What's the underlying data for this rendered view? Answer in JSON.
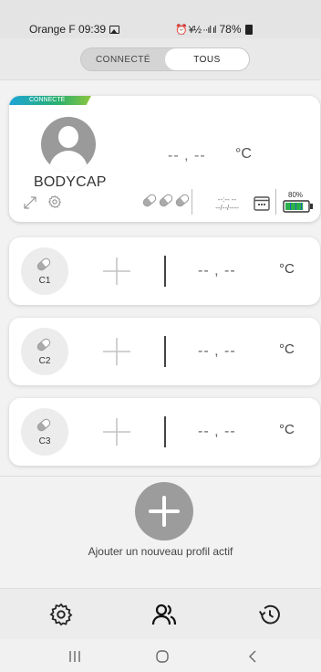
{
  "status_bar": {
    "carrier_time": "Orange F 09:39",
    "signal_glyphs": "⏰ ¥½ ··ıl ıl",
    "battery": "78%"
  },
  "filter": {
    "connected_label": "CONNECTÉ",
    "all_label": "TOUS",
    "active": "all"
  },
  "main_profile": {
    "badge": "CONNECTÉ",
    "name": "BODYCAP",
    "temperature": "-- , --",
    "unit": "°C",
    "time": "--:-- --",
    "date": "--/--/----",
    "battery_label": "80%",
    "battery_level": 0.8,
    "battery_color": "#2bb14a"
  },
  "capsules": [
    {
      "label": "C1",
      "temperature": "-- , --",
      "unit": "°C"
    },
    {
      "label": "C2",
      "temperature": "-- , --",
      "unit": "°C"
    },
    {
      "label": "C3",
      "temperature": "-- , --",
      "unit": "°C"
    }
  ],
  "add_profile": {
    "label": "Ajouter un nouveau profil actif"
  },
  "bottom_nav": {
    "items": [
      "settings-icon",
      "users-icon",
      "history-icon"
    ],
    "active": "users-icon"
  },
  "system_nav": {
    "items": [
      "recent-apps",
      "home",
      "back"
    ]
  }
}
